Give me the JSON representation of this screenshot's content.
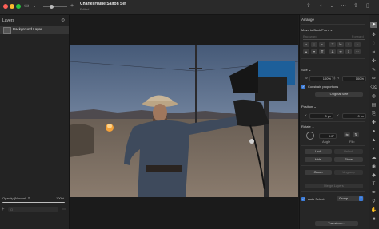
{
  "titlebar": {
    "title": "CharlesHaine Salton Set",
    "subtitle": "Edited"
  },
  "layers_panel": {
    "heading": "Layers",
    "layers": [
      {
        "name": "Background Layer"
      }
    ],
    "opacity_label": "Opacity (Normal) ⇕",
    "opacity_value": "100%",
    "opacity_fraction": 1.0,
    "search_placeholder": "Q"
  },
  "arrange_panel": {
    "heading": "Arrange",
    "move_section": "Move to Back/Front ⌄",
    "backward_label": "Backward",
    "forward_label": "Forward",
    "size_section": "Size ⌄",
    "w_label": "W",
    "w_value": "100%",
    "h_label": "H",
    "h_value": "100%",
    "constrain_label": "Constrain proportions",
    "original_size_label": "Original Size",
    "position_section": "Position ⌄",
    "x_label": "X",
    "x_value": "0 px",
    "y_label": "Y",
    "y_value": "0 px",
    "rotate_section": "Rotate ⌄",
    "angle_value": "0.0°",
    "angle_label": "Angle",
    "flip_label": "Flip",
    "lock_label": "Lock",
    "unlock_label": "Unlock",
    "hide_label": "Hide",
    "show_label": "Show",
    "group_label": "Group",
    "ungroup_label": "Ungroup",
    "merge_label": "Merge Layers",
    "auto_select_label": "Auto Select:",
    "auto_select_value": "Group",
    "transform_label": "Transform..."
  },
  "colors": {
    "accent": "#3b7bd8",
    "panel": "#262626",
    "canvas": "#1b1b1b"
  },
  "icons": {
    "toolbar": [
      "pointer-icon",
      "arrange-icon",
      "lasso-icon",
      "crop-icon",
      "move-icon",
      "brush-icon",
      "pencil-icon",
      "eraser-icon",
      "fill-icon",
      "gradient-icon",
      "clone-icon",
      "heal-icon",
      "blur-icon",
      "sharpen-icon",
      "dodge-icon",
      "sponge-icon",
      "red-eye-icon",
      "shape-icon",
      "text-icon",
      "pen-icon",
      "zoom-icon",
      "hand-icon",
      "color-icon",
      "eyedropper-icon"
    ]
  }
}
